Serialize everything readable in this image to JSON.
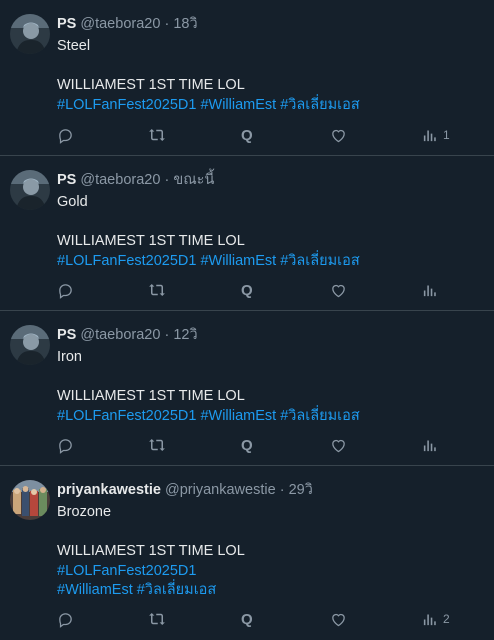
{
  "tweets": [
    {
      "name": "PS",
      "handle": "@taebora20",
      "time": "18วิ",
      "line1": "Steel",
      "line2": "WILLIAMEST 1ST TIME LOL",
      "tags_line1": [
        "#LOLFanFest2025D1",
        "#WilliamEst",
        "#วิลเลี่ยมเอส"
      ],
      "tags_line2": [],
      "views": "1",
      "avatar": "dark-portrait"
    },
    {
      "name": "PS",
      "handle": "@taebora20",
      "time": "ขณะนี้",
      "line1": "Gold",
      "line2": "WILLIAMEST 1ST TIME LOL",
      "tags_line1": [
        "#LOLFanFest2025D1",
        "#WilliamEst",
        "#วิลเลี่ยมเอส"
      ],
      "tags_line2": [],
      "views": "",
      "avatar": "dark-portrait"
    },
    {
      "name": "PS",
      "handle": "@taebora20",
      "time": "12วิ",
      "line1": "Iron",
      "line2": "WILLIAMEST 1ST TIME LOL",
      "tags_line1": [
        "#LOLFanFest2025D1",
        "#WilliamEst",
        "#วิลเลี่ยมเอส"
      ],
      "tags_line2": [],
      "views": "",
      "avatar": "dark-portrait"
    },
    {
      "name": "priyankawestie",
      "handle": "@priyankawestie",
      "time": "29วิ",
      "line1": "Brozone",
      "line2": "WILLIAMEST 1ST TIME LOL",
      "tags_line1": [
        "#LOLFanFest2025D1"
      ],
      "tags_line2": [
        "#WilliamEst",
        "#วิลเลี่ยมเอส"
      ],
      "views": "2",
      "avatar": "colorful-group"
    }
  ],
  "separator": "·",
  "quote_glyph": "Q",
  "icons": [
    "reply-icon",
    "retweet-icon",
    "quote-icon",
    "like-icon",
    "views-icon"
  ],
  "colors": {
    "background": "#15202b",
    "link": "#1d9bf0",
    "muted": "#8b98a5",
    "text": "#e7e9ea",
    "border": "#38444d"
  }
}
